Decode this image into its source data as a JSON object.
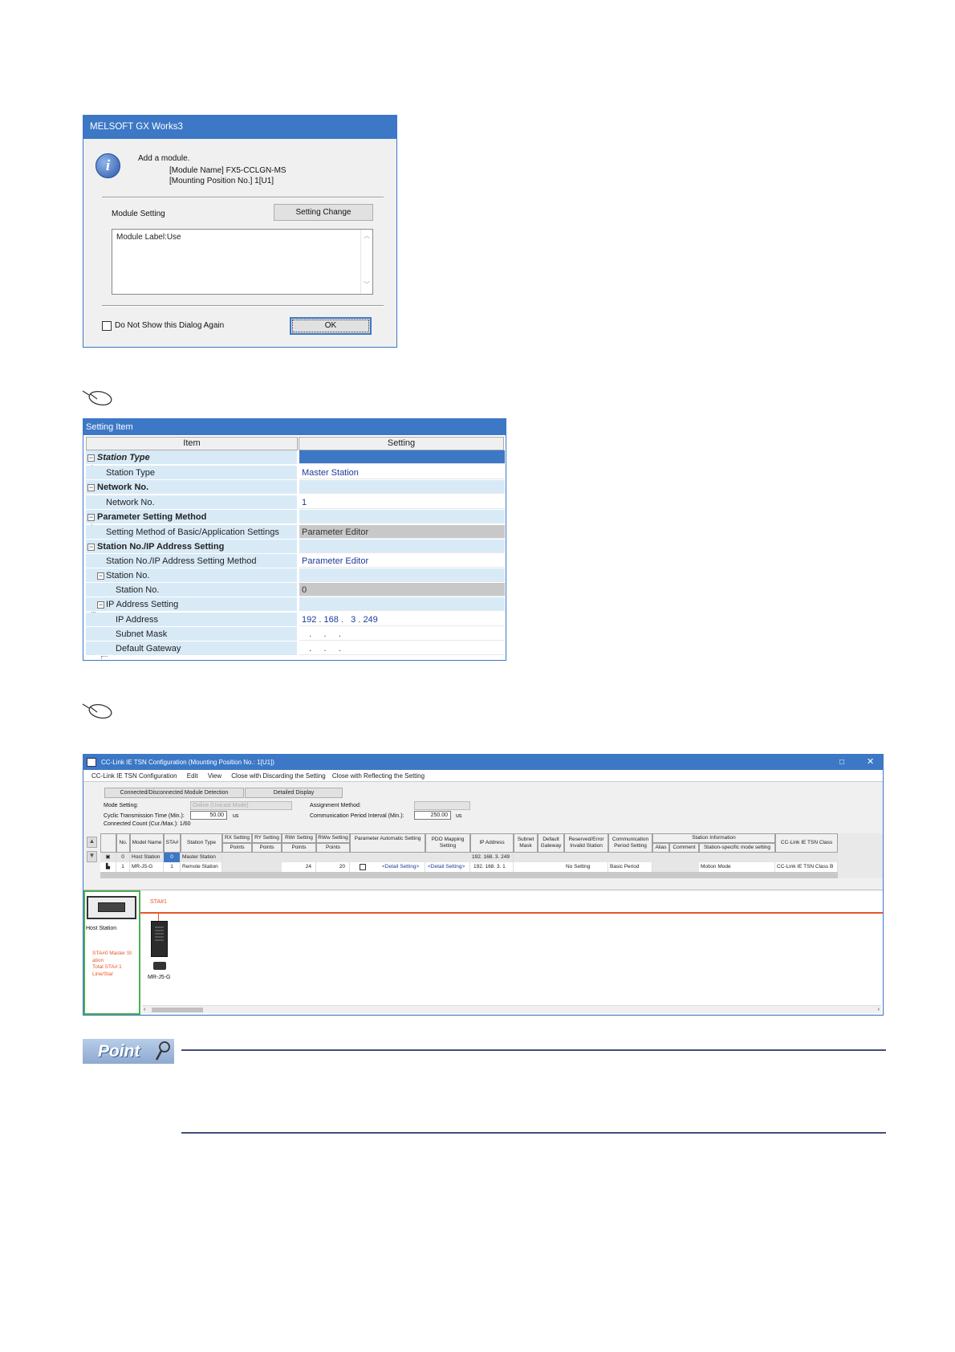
{
  "dialog": {
    "title": "MELSOFT GX Works3",
    "line1": "Add a module.",
    "line2": "[Module Name]  FX5-CCLGN-MS",
    "line3": "[Mounting Position No.]    1[U1]",
    "module_setting_label": "Module Setting",
    "setting_change_button": "Setting Change",
    "module_label_text": "Module Label:Use",
    "do_not_show": "Do Not Show this Dialog Again",
    "ok_button": "OK"
  },
  "setting_item": {
    "title": "Setting Item",
    "col_item": "Item",
    "col_setting": "Setting",
    "rows": [
      {
        "label": "Station Type",
        "value": ""
      },
      {
        "label": "Station Type",
        "value": "Master Station"
      },
      {
        "label": "Network No.",
        "value": ""
      },
      {
        "label": "Network No.",
        "value": "1"
      },
      {
        "label": "Parameter Setting Method",
        "value": ""
      },
      {
        "label": "Setting Method of Basic/Application Settings",
        "value": "Parameter Editor"
      },
      {
        "label": "Station No./IP Address Setting",
        "value": ""
      },
      {
        "label": "Station No./IP Address Setting Method",
        "value": "Parameter Editor"
      },
      {
        "label": "Station No.",
        "value": ""
      },
      {
        "label": "Station No.",
        "value": "0"
      },
      {
        "label": "IP Address Setting",
        "value": ""
      },
      {
        "label": "IP Address",
        "value": "192 . 168 .   3 . 249"
      },
      {
        "label": "Subnet Mask",
        "value": "   .     .     ."
      },
      {
        "label": "Default Gateway",
        "value": "   .     .     ."
      }
    ]
  },
  "cclink": {
    "title": "CC-Link IE TSN Configuration (Mounting Position No.: 1[U1])",
    "menu": [
      "CC-Link IE TSN Configuration",
      "Edit",
      "View",
      "Close with Discarding the Setting",
      "Close with Reflecting the Setting"
    ],
    "btn_detect": "Connected/Disconnected Module Detection",
    "btn_detail": "Detailed Display",
    "mode_setting_label": "Mode Setting:",
    "mode_setting_value": "Online (Unicast Mode)",
    "assignment_label": "Assignment Method:",
    "cyclic_label": "Cyclic Transmission Time (Min.):",
    "cyclic_value": "50.00",
    "cyclic_unit": "us",
    "comm_label": "Communication Period Interval (Min.):",
    "comm_value": "250.00",
    "comm_unit": "us",
    "connected_count": "Connected Count (Cur./Max.):  1/60",
    "headers": {
      "no": "No.",
      "model": "Model Name",
      "sta": "STA#",
      "type": "Station Type",
      "rx": "RX Setting",
      "ry": "RY Setting",
      "rwr": "RWr Setting",
      "rww": "RWw Setting",
      "points": "Points",
      "param": "Parameter Automatic Setting",
      "pdo": "PDO Mapping Setting",
      "ip": "IP Address",
      "subnet": "Subnet Mask",
      "gw": "Default Gateway",
      "reserved": "Reserved/Error Invalid Station",
      "commset": "Communication Period Setting",
      "info": "Station Information",
      "alias": "Alias",
      "comment": "Comment",
      "specific": "Station-specific mode setting",
      "cls": "CC-Link IE TSN Class"
    },
    "rows": [
      {
        "no": "0",
        "model": "Host Station",
        "sta": "0",
        "type": "Master Station",
        "rwr": "",
        "rww": "",
        "pdo_detail": "",
        "pdo_map": "",
        "ip": "192. 168. 3. 249",
        "reserved": "",
        "commset": "",
        "specific": "",
        "cls": ""
      },
      {
        "no": "1",
        "model": "MR-J5-G",
        "sta": "1",
        "type": "Remote Station",
        "rwr": "24",
        "rww": "20",
        "pdo_detail": "<Detail Setting>",
        "pdo_map": "<Detail Setting>",
        "ip": "192. 168. 3. 1",
        "reserved": "No Setting",
        "commset": "Basic Period",
        "specific": "Motion Mode",
        "cls": "CC-Link IE TSN Class B"
      }
    ],
    "host_label": "Host Station",
    "host_info": [
      "STA#0  Master St",
      "ation",
      "Total STA#:1",
      "Line/Star"
    ],
    "sta_label": "STA#1",
    "device_label": "MR-J5-G"
  },
  "point": {
    "label": "Point"
  },
  "colors": {
    "accent": "#3c78c6",
    "line": "#e8562a",
    "panel": "#d9eaf7"
  }
}
